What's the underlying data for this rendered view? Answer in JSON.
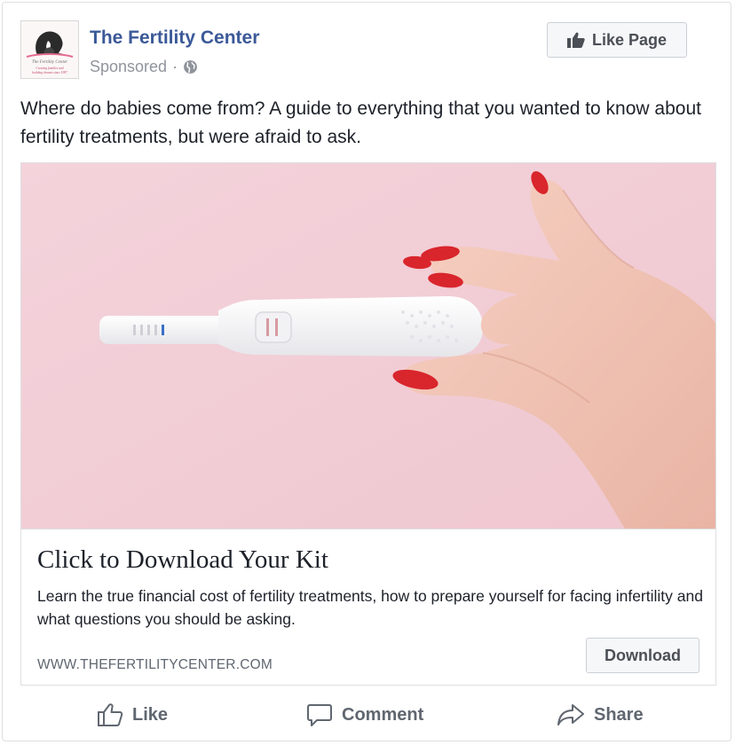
{
  "post": {
    "page_name": "The Fertility Center",
    "sponsored_label": "Sponsored",
    "separator": "·",
    "like_page_label": "Like Page",
    "text": "Where do babies come from? A guide to everything that you wanted to know about fertility treatments, but were afraid to ask.",
    "avatar_logo_text": {
      "name": "The Fertility Center",
      "tagline_line1": "Creating families and",
      "tagline_line2": "building dreams since 1997"
    }
  },
  "attachment": {
    "image_icon": "pregnancy-test-in-hand-photo",
    "headline": "Click to Download Your Kit",
    "description": "Learn the true financial cost of fertility treatments, how to prepare yourself for facing infertility and what questions you should be asking.",
    "domain": "WWW.THEFERTILITYCENTER.COM",
    "cta_label": "Download"
  },
  "actions": {
    "like": "Like",
    "comment": "Comment",
    "share": "Share"
  },
  "colors": {
    "page_name": "#3b5998",
    "muted_text": "#90949c",
    "body_text": "#1d2129",
    "button_bg": "#f6f7f9",
    "button_border": "#ccd0d5",
    "hero_background": "#f2cdd6",
    "nail_polish": "#d9252c"
  }
}
